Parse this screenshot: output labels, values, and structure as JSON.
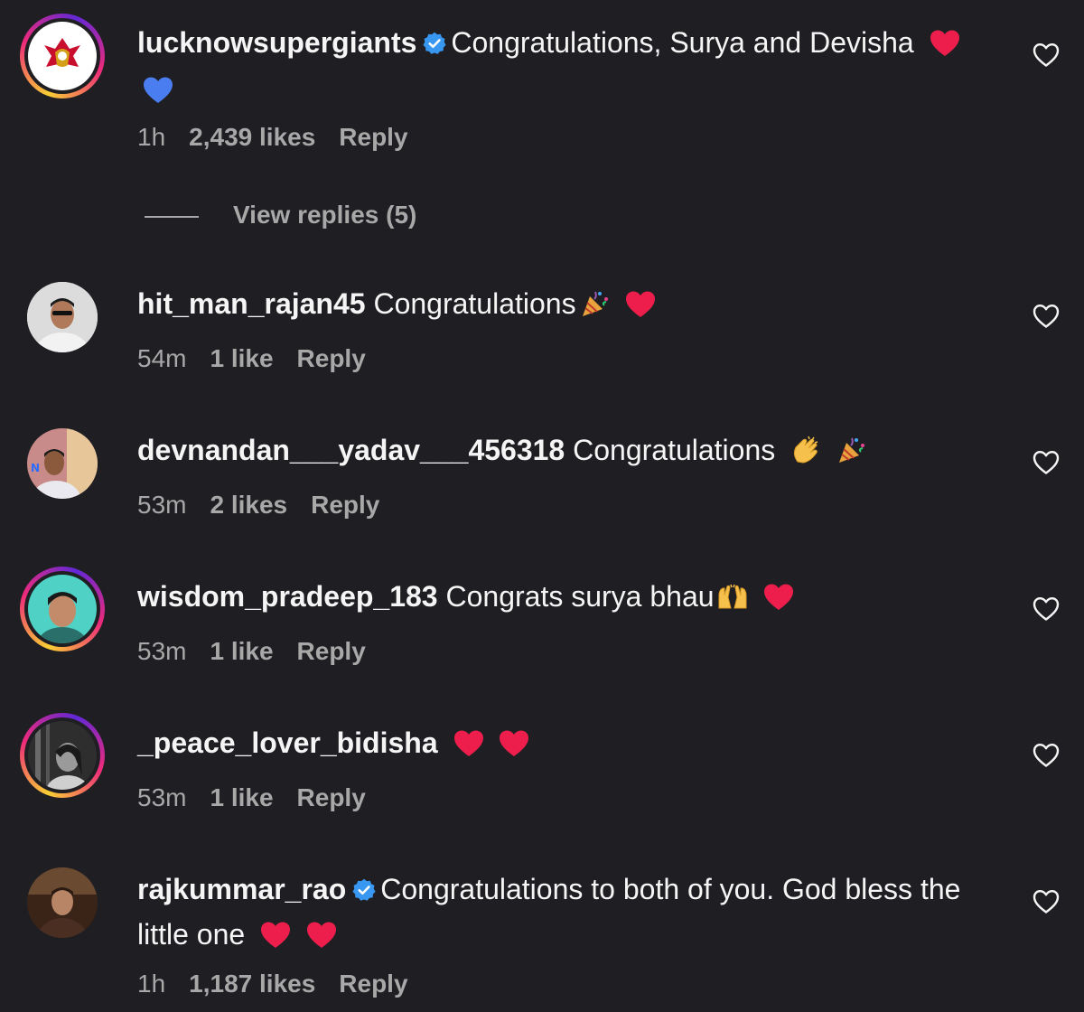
{
  "comments": [
    {
      "username": "lucknowsupergiants",
      "verified": true,
      "text": "Congratulations, Surya and Devisha",
      "emojis": [
        "red-heart",
        "blue-heart"
      ],
      "time": "1h",
      "likes": "2,439 likes",
      "reply": "Reply",
      "view_replies": "View replies (5)"
    },
    {
      "username": "hit_man_rajan45",
      "verified": false,
      "text": "Congratulations",
      "emojis": [
        "party-popper",
        "red-heart"
      ],
      "time": "54m",
      "likes": "1 like",
      "reply": "Reply"
    },
    {
      "username": "devnandan___yadav___456318",
      "verified": false,
      "text": "Congratulations",
      "emojis": [
        "clapping-hands",
        "party-popper"
      ],
      "time": "53m",
      "likes": "2 likes",
      "reply": "Reply"
    },
    {
      "username": "wisdom_pradeep_183",
      "verified": false,
      "text": "Congrats surya bhau",
      "emojis": [
        "raising-hands",
        "red-heart"
      ],
      "time": "53m",
      "likes": "1 like",
      "reply": "Reply"
    },
    {
      "username": "_peace_lover_bidisha",
      "verified": false,
      "text": "",
      "emojis": [
        "red-heart",
        "red-heart"
      ],
      "time": "53m",
      "likes": "1 like",
      "reply": "Reply"
    },
    {
      "username": "rajkummar_rao",
      "verified": true,
      "text": "Congratulations to both of you. God bless the little one",
      "emojis": [
        "red-heart",
        "red-heart"
      ],
      "time": "1h",
      "likes": "1,187 likes",
      "reply": "Reply"
    }
  ],
  "colors": {
    "background": "#1f1f23",
    "text": "#f5f5f5",
    "secondary": "#a8a8a8",
    "verified": "#3897f0",
    "heart": "#ed1e4c"
  }
}
